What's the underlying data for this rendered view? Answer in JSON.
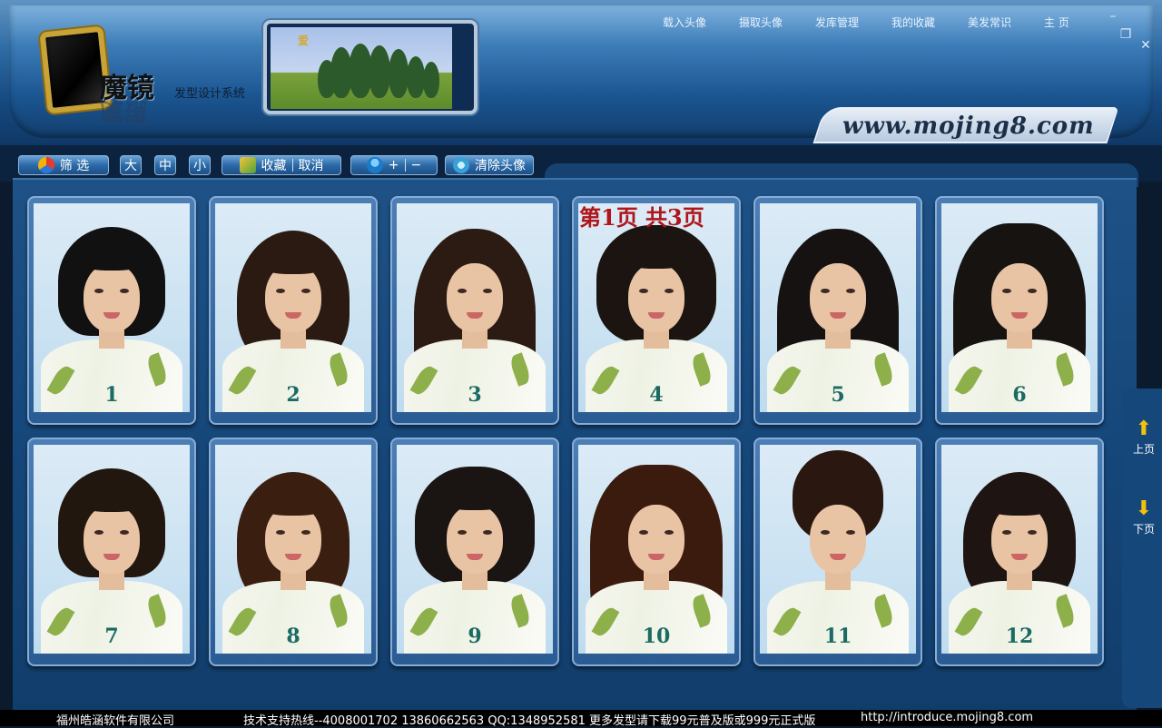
{
  "header": {
    "logo_title": "魔镜",
    "logo_subtitle": "发型设计系统",
    "banner_mark": "爱",
    "menu": [
      "载入头像",
      "摄取头像",
      "发库管理",
      "我的收藏",
      "美发常识",
      "主 页"
    ],
    "url": "www.mojing8.com"
  },
  "toolbar": {
    "filter": "筛 选",
    "size_large": "大",
    "size_medium": "中",
    "size_small": "小",
    "favorite": "收藏",
    "cancel": "取消",
    "zoom_in": "+",
    "zoom_out": "−",
    "clear_avatar": "清除头像"
  },
  "page_indicator": "第1页  共3页",
  "styles": [
    {
      "num": "1",
      "hair": "#111111",
      "shape": "bob"
    },
    {
      "num": "2",
      "hair": "#2a1a12",
      "shape": "medium"
    },
    {
      "num": "3",
      "hair": "#2b1b12",
      "shape": "long"
    },
    {
      "num": "4",
      "hair": "#1b1411",
      "shape": "shag"
    },
    {
      "num": "5",
      "hair": "#161212",
      "shape": "long"
    },
    {
      "num": "6",
      "hair": "#171311",
      "shape": "curly"
    },
    {
      "num": "7",
      "hair": "#22170f",
      "shape": "bob"
    },
    {
      "num": "8",
      "hair": "#3a1e10",
      "shape": "medium"
    },
    {
      "num": "9",
      "hair": "#1a1412",
      "shape": "shag"
    },
    {
      "num": "10",
      "hair": "#3b1b0e",
      "shape": "curly"
    },
    {
      "num": "11",
      "hair": "#2a170f",
      "shape": "updo"
    },
    {
      "num": "12",
      "hair": "#1e1512",
      "shape": "medium"
    }
  ],
  "pagination": {
    "prev": "上页",
    "next": "下页"
  },
  "footer": {
    "company": "福州皓涵软件有限公司",
    "hotline": "技术支持热线--4008001702 13860662563 QQ:1348952581 更多发型请下载99元普及版或999元正式版",
    "link": "http://introduce.mojing8.com"
  },
  "colors": {
    "accent": "#1e5287",
    "page_indicator": "#b0151a",
    "number": "#1b6a64",
    "arrow": "#f2c20e"
  }
}
